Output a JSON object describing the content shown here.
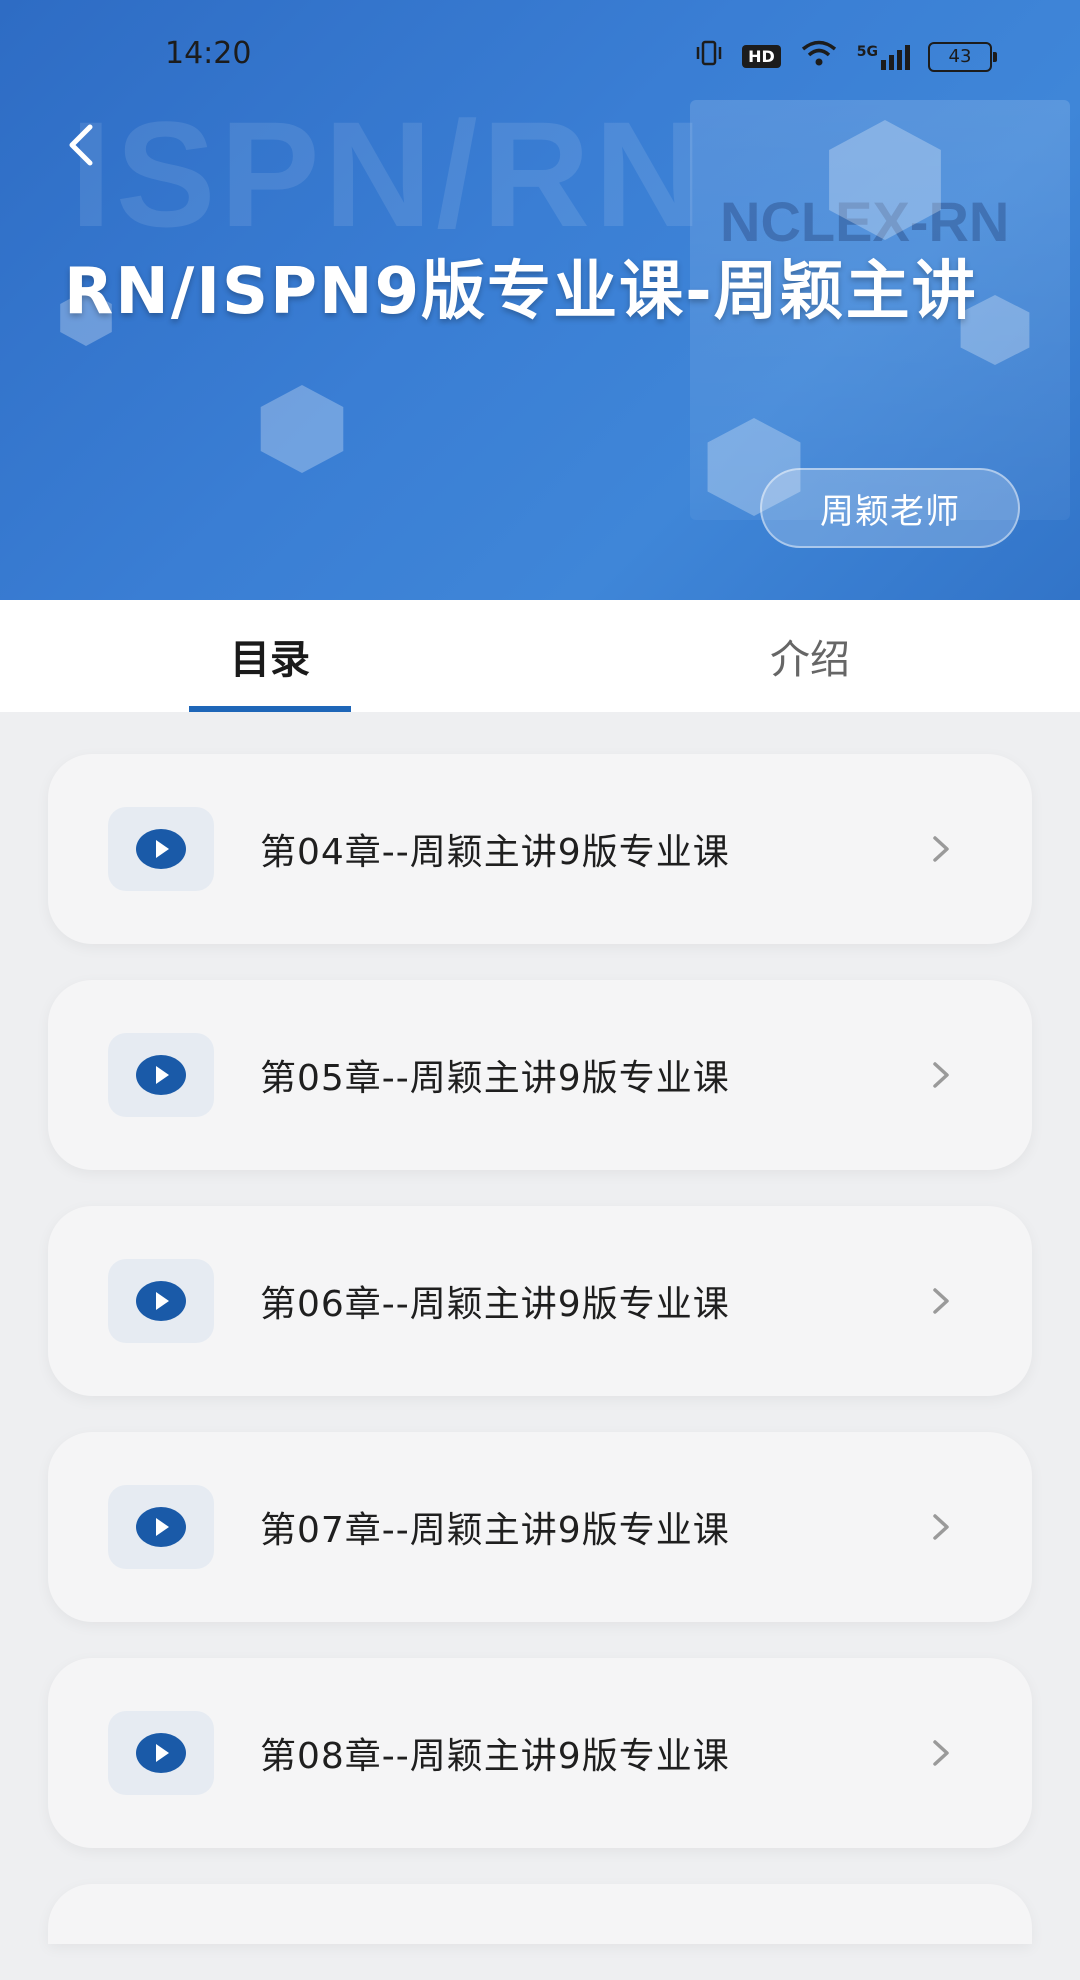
{
  "status_bar": {
    "time": "14:20",
    "hd": "HD",
    "network": "5G",
    "battery": "43"
  },
  "hero": {
    "watermark": "ISPN/RN",
    "book_text": [
      "NCLEX-RN"
    ],
    "title": "RN/ISPN9版专业课-周颖主讲",
    "teacher_badge": "周颖老师"
  },
  "tabs": [
    {
      "label": "目录",
      "active": true
    },
    {
      "label": "介绍",
      "active": false
    }
  ],
  "chapters": [
    {
      "label": "第04章--周颖主讲9版专业课"
    },
    {
      "label": "第05章--周颖主讲9版专业课"
    },
    {
      "label": "第06章--周颖主讲9版专业课"
    },
    {
      "label": "第07章--周颖主讲9版专业课"
    },
    {
      "label": "第08章--周颖主讲9版专业课"
    }
  ],
  "colors": {
    "accent": "#1e66b8",
    "hero_blue": "#3a7ed4",
    "card_bg": "#f5f5f6"
  },
  "icons": {
    "back": "chevron-left-icon",
    "play": "play-circle-icon",
    "chevron": "chevron-right-icon"
  }
}
